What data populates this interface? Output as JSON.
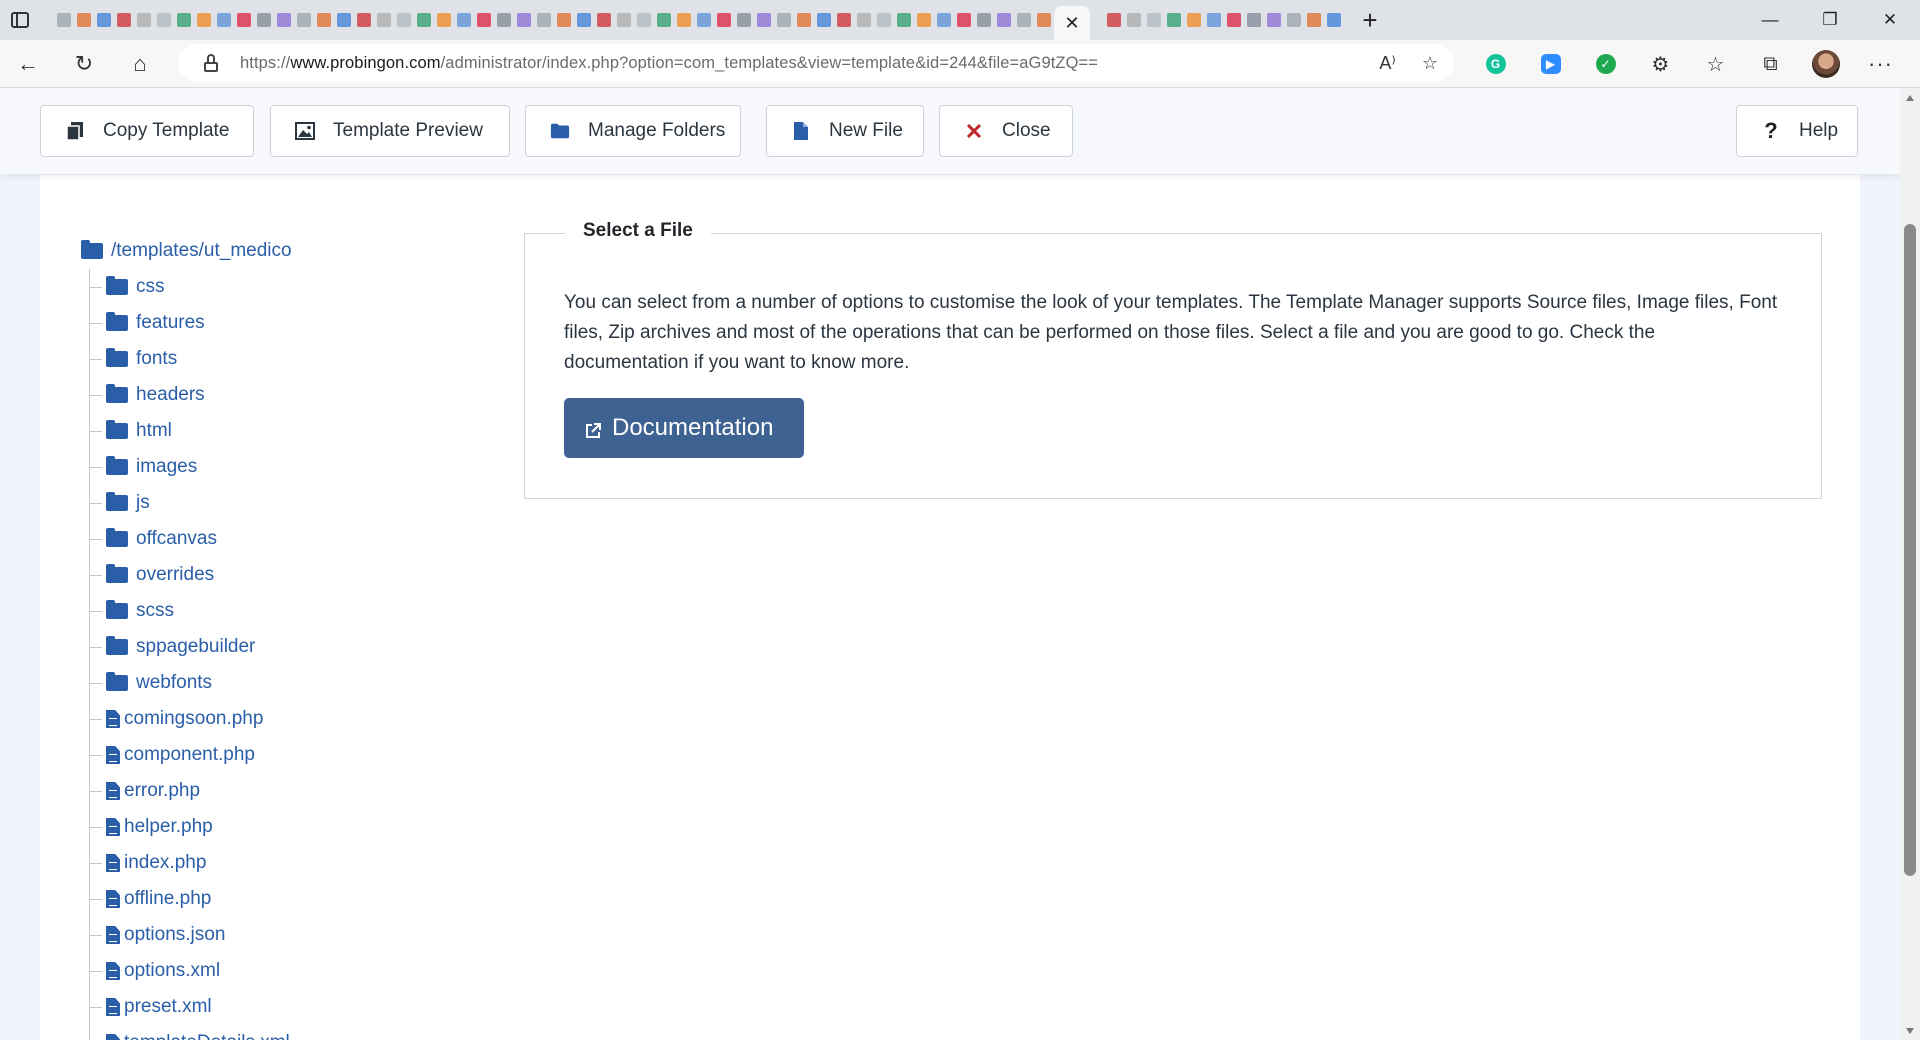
{
  "browser": {
    "url_prefix": "https://",
    "url_host": "www.probingon.com",
    "url_path": "/administrator/index.php?option=com_templates&view=template&id=244&file=aG9tZQ=="
  },
  "toolbar": {
    "copy_template": "Copy Template",
    "template_preview": "Template Preview",
    "manage_folders": "Manage Folders",
    "new_file": "New File",
    "close": "Close",
    "help": "Help"
  },
  "tree": {
    "root": "/templates/ut_medico",
    "folders": [
      "css",
      "features",
      "fonts",
      "headers",
      "html",
      "images",
      "js",
      "offcanvas",
      "overrides",
      "scss",
      "sppagebuilder",
      "webfonts"
    ],
    "files": [
      "comingsoon.php",
      "component.php",
      "error.php",
      "helper.php",
      "index.php",
      "offline.php",
      "options.json",
      "options.xml",
      "preset.xml",
      "templateDetails.xml"
    ]
  },
  "select_file": {
    "legend": "Select a File",
    "description": "You can select from a number of options to customise the look of your templates. The Template Manager supports Source files, Image files, Font files, Zip archives and most of the operations that can be performed on those files. Select a file and you are good to go. Check the documentation if you want to know more.",
    "documentation_button": "Documentation"
  },
  "colors": {
    "link_blue": "#2a5ea8",
    "doc_button": "#3e6291",
    "close_red": "#c0282d"
  }
}
